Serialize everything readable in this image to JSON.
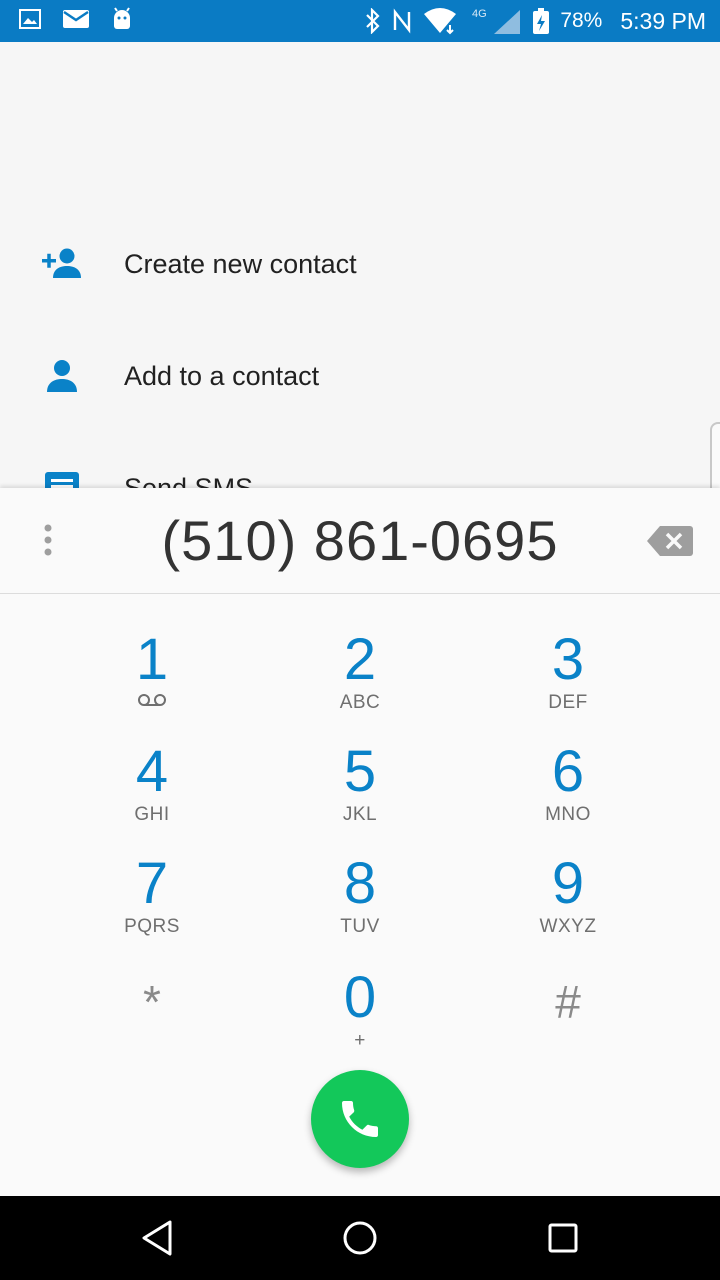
{
  "status_bar": {
    "battery": "78%",
    "time": "5:39 PM",
    "icons_left": [
      "gallery-icon",
      "mail-icon",
      "android-icon"
    ],
    "icons_right": [
      "bluetooth-icon",
      "nfc-icon",
      "wifi-icon",
      "signal-4g-icon",
      "battery-icon"
    ],
    "background": "#0a7bc4"
  },
  "actions": [
    {
      "label": "Create new contact",
      "icon": "add-person-icon"
    },
    {
      "label": "Add to a contact",
      "icon": "person-icon"
    },
    {
      "label": "Send SMS",
      "icon": "message-icon"
    }
  ],
  "dialer": {
    "number": "(510) 861-0695",
    "keys": [
      {
        "digit": "1",
        "letters": ""
      },
      {
        "digit": "2",
        "letters": "ABC"
      },
      {
        "digit": "3",
        "letters": "DEF"
      },
      {
        "digit": "4",
        "letters": "GHI"
      },
      {
        "digit": "5",
        "letters": "JKL"
      },
      {
        "digit": "6",
        "letters": "MNO"
      },
      {
        "digit": "7",
        "letters": "PQRS"
      },
      {
        "digit": "8",
        "letters": "TUV"
      },
      {
        "digit": "9",
        "letters": "WXYZ"
      },
      {
        "digit": "*",
        "letters": ""
      },
      {
        "digit": "0",
        "letters": "+"
      },
      {
        "digit": "#",
        "letters": ""
      }
    ],
    "accent": "#0a82c8",
    "call_color": "#13c85a"
  },
  "nav_bar": {
    "buttons": [
      "back-icon",
      "home-icon",
      "recents-icon"
    ]
  }
}
